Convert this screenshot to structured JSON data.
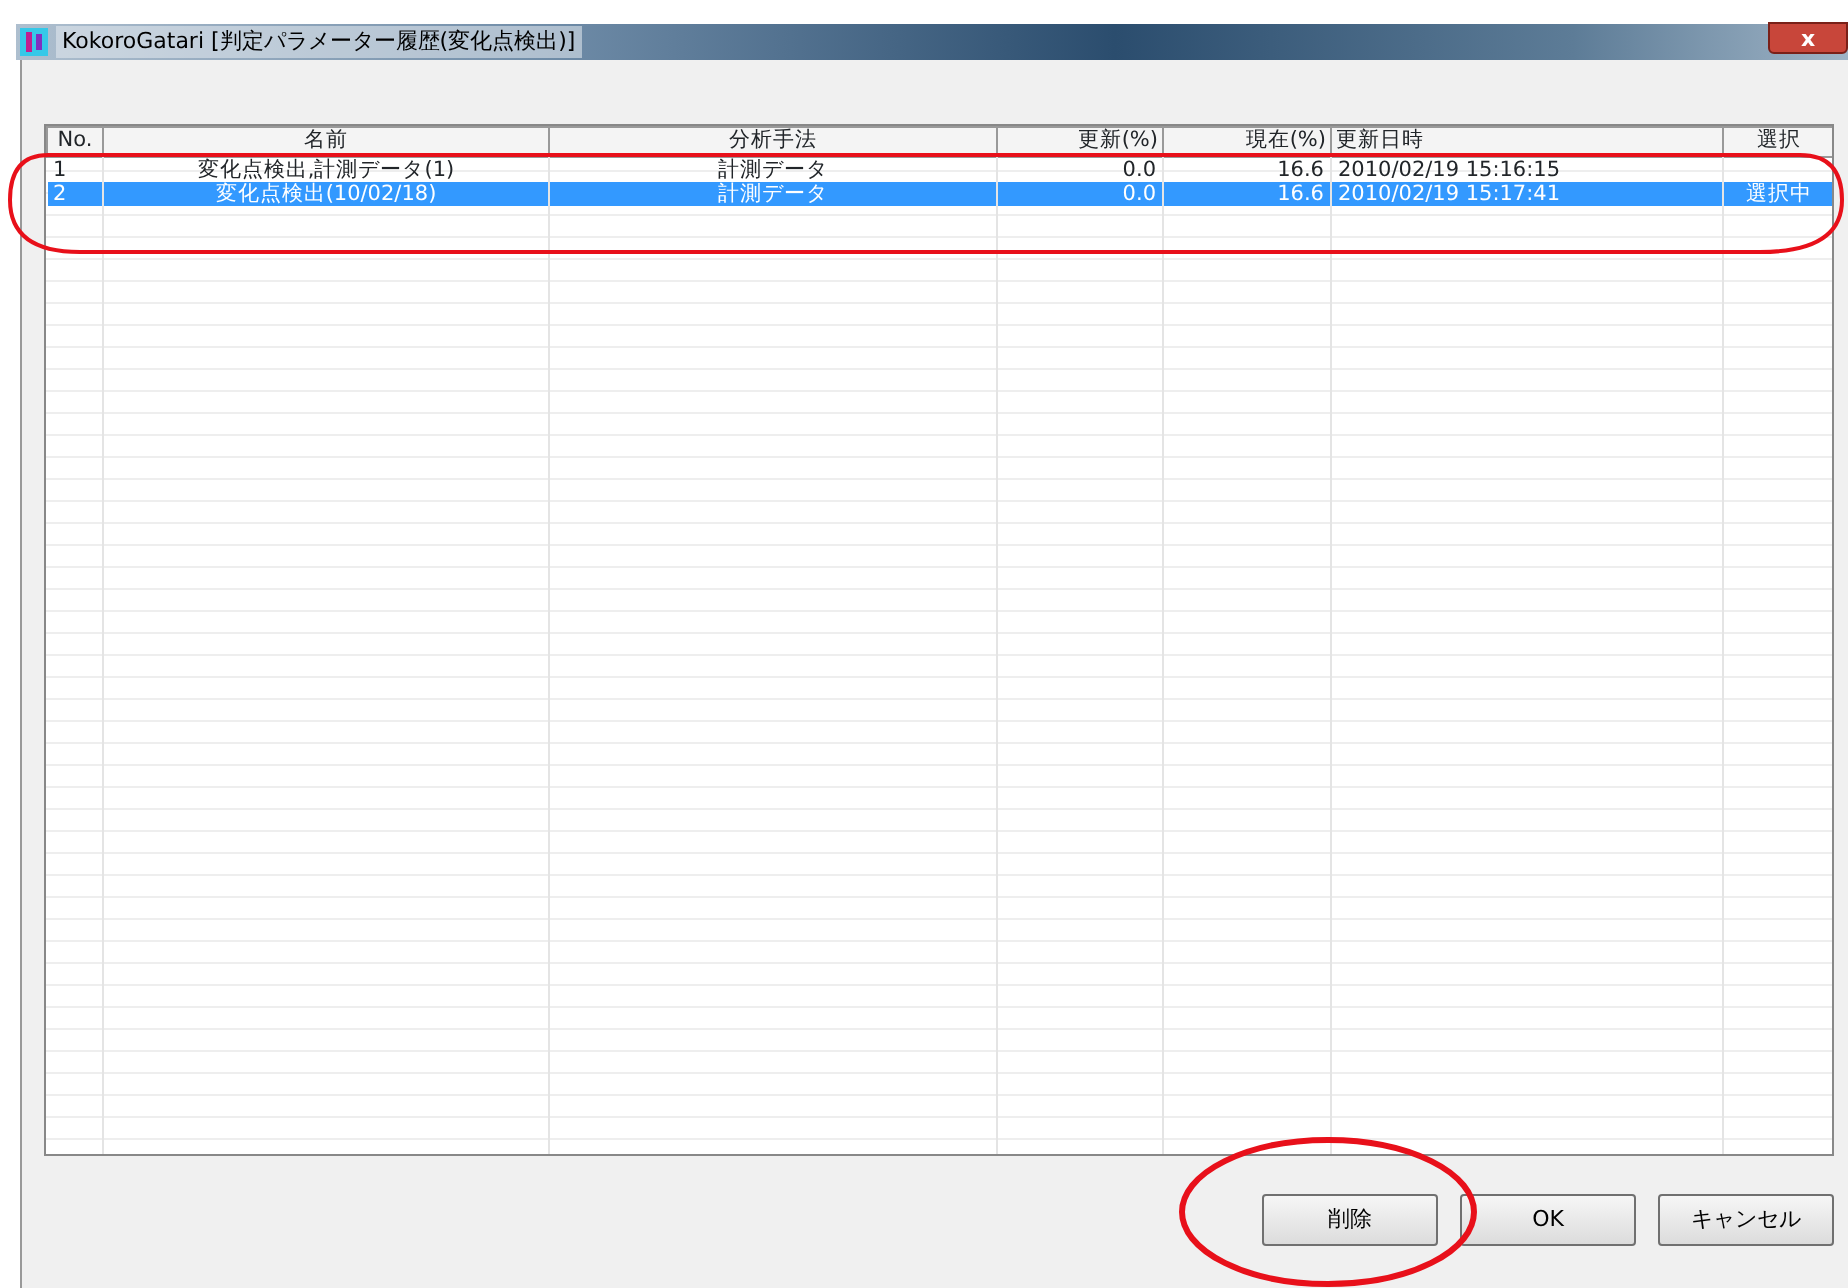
{
  "window": {
    "title": "KokoroGatari [判定パラメーター履歴(変化点検出)]",
    "close": "x"
  },
  "table": {
    "columns": [
      "No.",
      "名前",
      "分析手法",
      "更新(%)",
      "現在(%)",
      "更新日時",
      "選択"
    ],
    "rows": [
      {
        "cells": [
          "1",
          "変化点検出,計測データ(1)",
          "計測データ",
          "0.0",
          "16.6",
          "2010/02/19 15:16:15",
          ""
        ],
        "selected": false
      },
      {
        "cells": [
          "2",
          "変化点検出(10/02/18)",
          "計測データ",
          "0.0",
          "16.6",
          "2010/02/19 15:17:41",
          "選択中"
        ],
        "selected": true
      }
    ]
  },
  "buttons": [
    "削除",
    "OK",
    "キャンセル"
  ],
  "annotations": [
    {
      "kind": "ellipse"
    },
    {
      "kind": "ellipse"
    }
  ]
}
